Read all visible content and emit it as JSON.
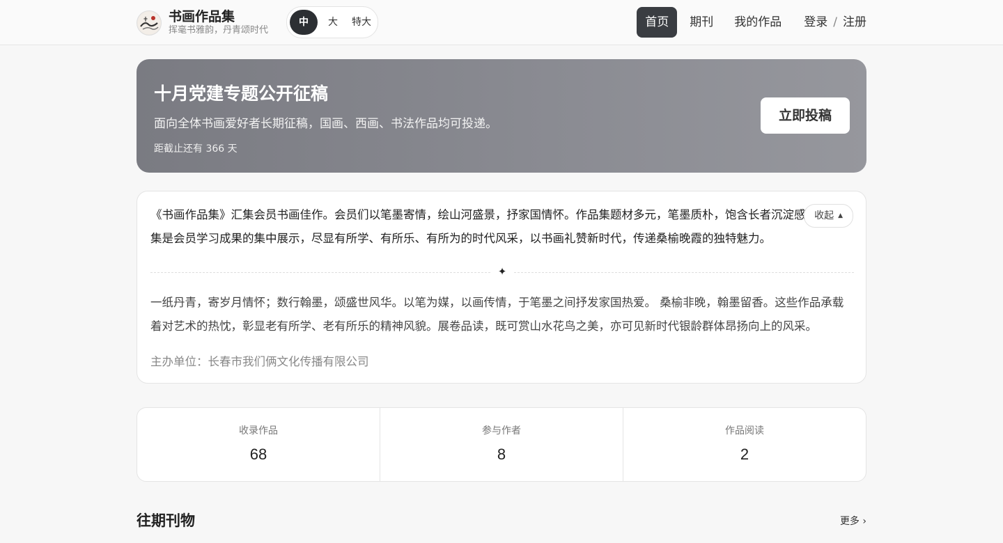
{
  "brand": {
    "title": "书画作品集",
    "subtitle": "挥毫书雅韵，丹青颂时代",
    "logo_icon": "ink-painting-logo-icon"
  },
  "font_size_switch": {
    "options": [
      "中",
      "大",
      "特大"
    ],
    "selected": "中"
  },
  "nav": {
    "items": [
      "首页",
      "期刊",
      "我的作品"
    ],
    "active": "首页",
    "login": "登录",
    "separator": "/",
    "register": "注册"
  },
  "banner": {
    "title": "十月党建专题公开征稿",
    "description": "面向全体书画爱好者长期征稿，国画、西画、书法作品均可投递。",
    "deadline": "距截止还有 366 天",
    "button": "立即投稿"
  },
  "intro": {
    "paragraph1": "《书画作品集》汇集会员书画佳作。会员们以笔墨寄情，绘山河盛景，抒家国情怀。作品集题材多元，笔墨质朴，饱含长者沉淀感悟。 本集是会员学习成果的集中展示，尽显有所学、有所乐、有所为的时代风采，以书画礼赞新时代，传递桑榆晚霞的独特魅力。",
    "collapse_button": "收起",
    "collapse_icon": "caret-up-icon",
    "divider_icon": "sparkle-star-icon",
    "divider_glyph": "✦",
    "paragraph2": "一纸丹青，寄岁月情怀；数行翰墨，颂盛世风华。以笔为媒，以画传情，于笔墨之间抒发家国热爱。 桑榆非晚，翰墨留香。这些作品承载着对艺术的热忱，彰显老有所学、老有所乐的精神风貌。展卷品读，既可赏山水花鸟之美，亦可见新时代银龄群体昂扬向上的风采。",
    "organizer": "主办单位：长春市我们俩文化传播有限公司"
  },
  "stats": [
    {
      "label": "收录作品",
      "value": "68"
    },
    {
      "label": "参与作者",
      "value": "8"
    },
    {
      "label": "作品阅读",
      "value": "2"
    }
  ],
  "past_issues": {
    "title": "往期刊物",
    "more": "更多 ›"
  },
  "colors": {
    "nav_active_bg": "#3a3d42",
    "banner_bg": "#8a8b92",
    "page_bg": "#f7f7f7"
  }
}
